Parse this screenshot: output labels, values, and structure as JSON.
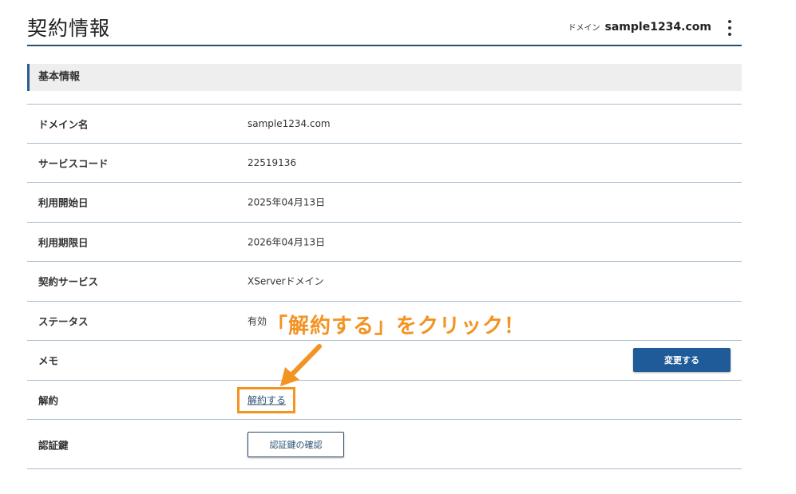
{
  "header": {
    "title": "契約情報",
    "domain_label": "ドメイン",
    "domain_value": "sample1234.com",
    "menu_icon": "kebab-vertical-icon"
  },
  "section": {
    "title": "基本情報"
  },
  "rows": {
    "domain_name": {
      "label": "ドメイン名",
      "value": "sample1234.com"
    },
    "service_code": {
      "label": "サービスコード",
      "value": "22519136"
    },
    "start_date": {
      "label": "利用開始日",
      "value": "2025年04月13日"
    },
    "end_date": {
      "label": "利用期限日",
      "value": "2026年04月13日"
    },
    "contract_service": {
      "label": "契約サービス",
      "value": "XServerドメイン"
    },
    "status": {
      "label": "ステータス",
      "value": "有効"
    },
    "memo": {
      "label": "メモ",
      "button": "変更する"
    },
    "cancel": {
      "label": "解約",
      "link": "解約する"
    },
    "auth_key": {
      "label": "認証鍵",
      "button": "認証鍵の確認"
    }
  },
  "annotation": {
    "text": "「解約する」をクリック！",
    "color": "#f39322"
  },
  "colors": {
    "accent": "#1f5a99",
    "header_border": "#2b4f72",
    "row_border": "#a9bccd",
    "section_bg": "#eeeeee"
  }
}
